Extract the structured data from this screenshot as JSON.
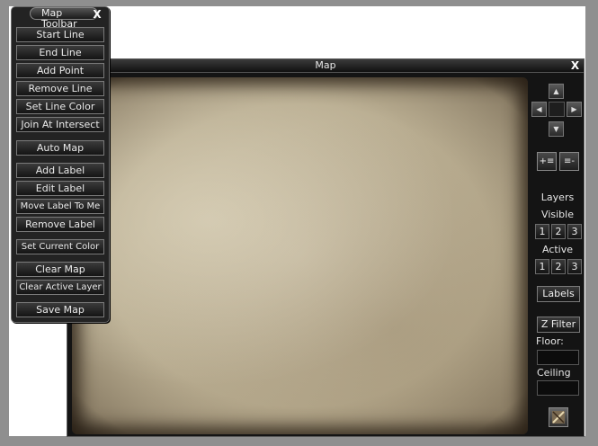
{
  "toolbar": {
    "title": "Map Toolbar",
    "close_label": "X",
    "buttons": [
      "Start Line",
      "End Line",
      "Add Point",
      "Remove Line",
      "Set Line Color",
      "Join At Intersect",
      "Auto Map",
      "Add Label",
      "Edit Label",
      "Move Label To Me",
      "Remove Label",
      "Set Current Color",
      "Clear Map",
      "Clear Active Layer",
      "Save Map"
    ]
  },
  "map_window": {
    "title": "Map",
    "close_label": "X",
    "icons": {
      "pan_up": "triangle-up-icon",
      "pan_down": "triangle-down-icon",
      "pan_left": "triangle-left-icon",
      "pan_right": "triangle-right-icon",
      "zoom_in": "zoom-in-icon",
      "zoom_out": "zoom-out-icon",
      "sketch": "sketch-icon"
    },
    "panel": {
      "layers_label": "Layers",
      "visible_label": "Visible",
      "visible_layers": [
        "1",
        "2",
        "3"
      ],
      "active_label": "Active",
      "active_layers": [
        "1",
        "2",
        "3"
      ],
      "labels_button": "Labels",
      "zfilter_button": "Z Filter",
      "floor_label": "Floor:",
      "floor_value": "",
      "ceiling_label": "Ceiling",
      "ceiling_value": ""
    }
  },
  "colors": {
    "parchment": "#c8bda4",
    "window_bg": "#141414",
    "desktop": "#8f8f8f"
  }
}
